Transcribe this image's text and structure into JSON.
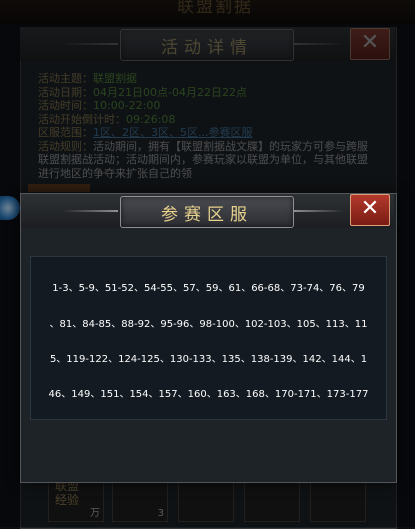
{
  "background": {
    "game_title": "联盟割据",
    "detail_dialog": {
      "title": "活动详情",
      "close_label": "✕",
      "rows": [
        {
          "key": "活动主题：",
          "value": "联盟割据"
        },
        {
          "key": "活动日期：",
          "value": "04月21日00点-04月22日22点"
        },
        {
          "key": "活动时间：",
          "value": "10:00-22:00"
        },
        {
          "key": "活动开始倒计时：",
          "value": "09:26:08"
        },
        {
          "key": "区服范围：",
          "value": "1区、2区、3区、5区...参赛区服"
        },
        {
          "key": "活动规则：",
          "value": "活动期间，拥有【联盟割据战文牒】的玩家方可参与跨服联盟割据战活动；活动期间内，参赛玩家以联盟为单位，与其他联盟进行地区的争夺来扩张自己的领"
        }
      ],
      "reward_slots": [
        {
          "label": "联盟\n经验",
          "count": "万"
        },
        {
          "label": "",
          "count": "3"
        },
        {
          "label": "",
          "count": ""
        },
        {
          "label": "",
          "count": ""
        },
        {
          "label": "",
          "count": ""
        }
      ]
    }
  },
  "server_dialog": {
    "title": "参赛区服",
    "close_label": "✕",
    "lines": [
      "1-3、5-9、51-52、54-55、57、59、61、66-68、73-74、76、79",
      "、81、84-85、88-92、95-96、98-100、102-103、105、113、11",
      "5、119-122、124-125、130-133、135、138-139、142、144、1",
      "46、149、151、154、157、160、163、168、170-171、173-177"
    ]
  },
  "colors": {
    "gold_text": "#e8d28c",
    "green_value": "#7fdc4a",
    "close_red": "#b23a2c",
    "panel_bg": "#131a22"
  }
}
